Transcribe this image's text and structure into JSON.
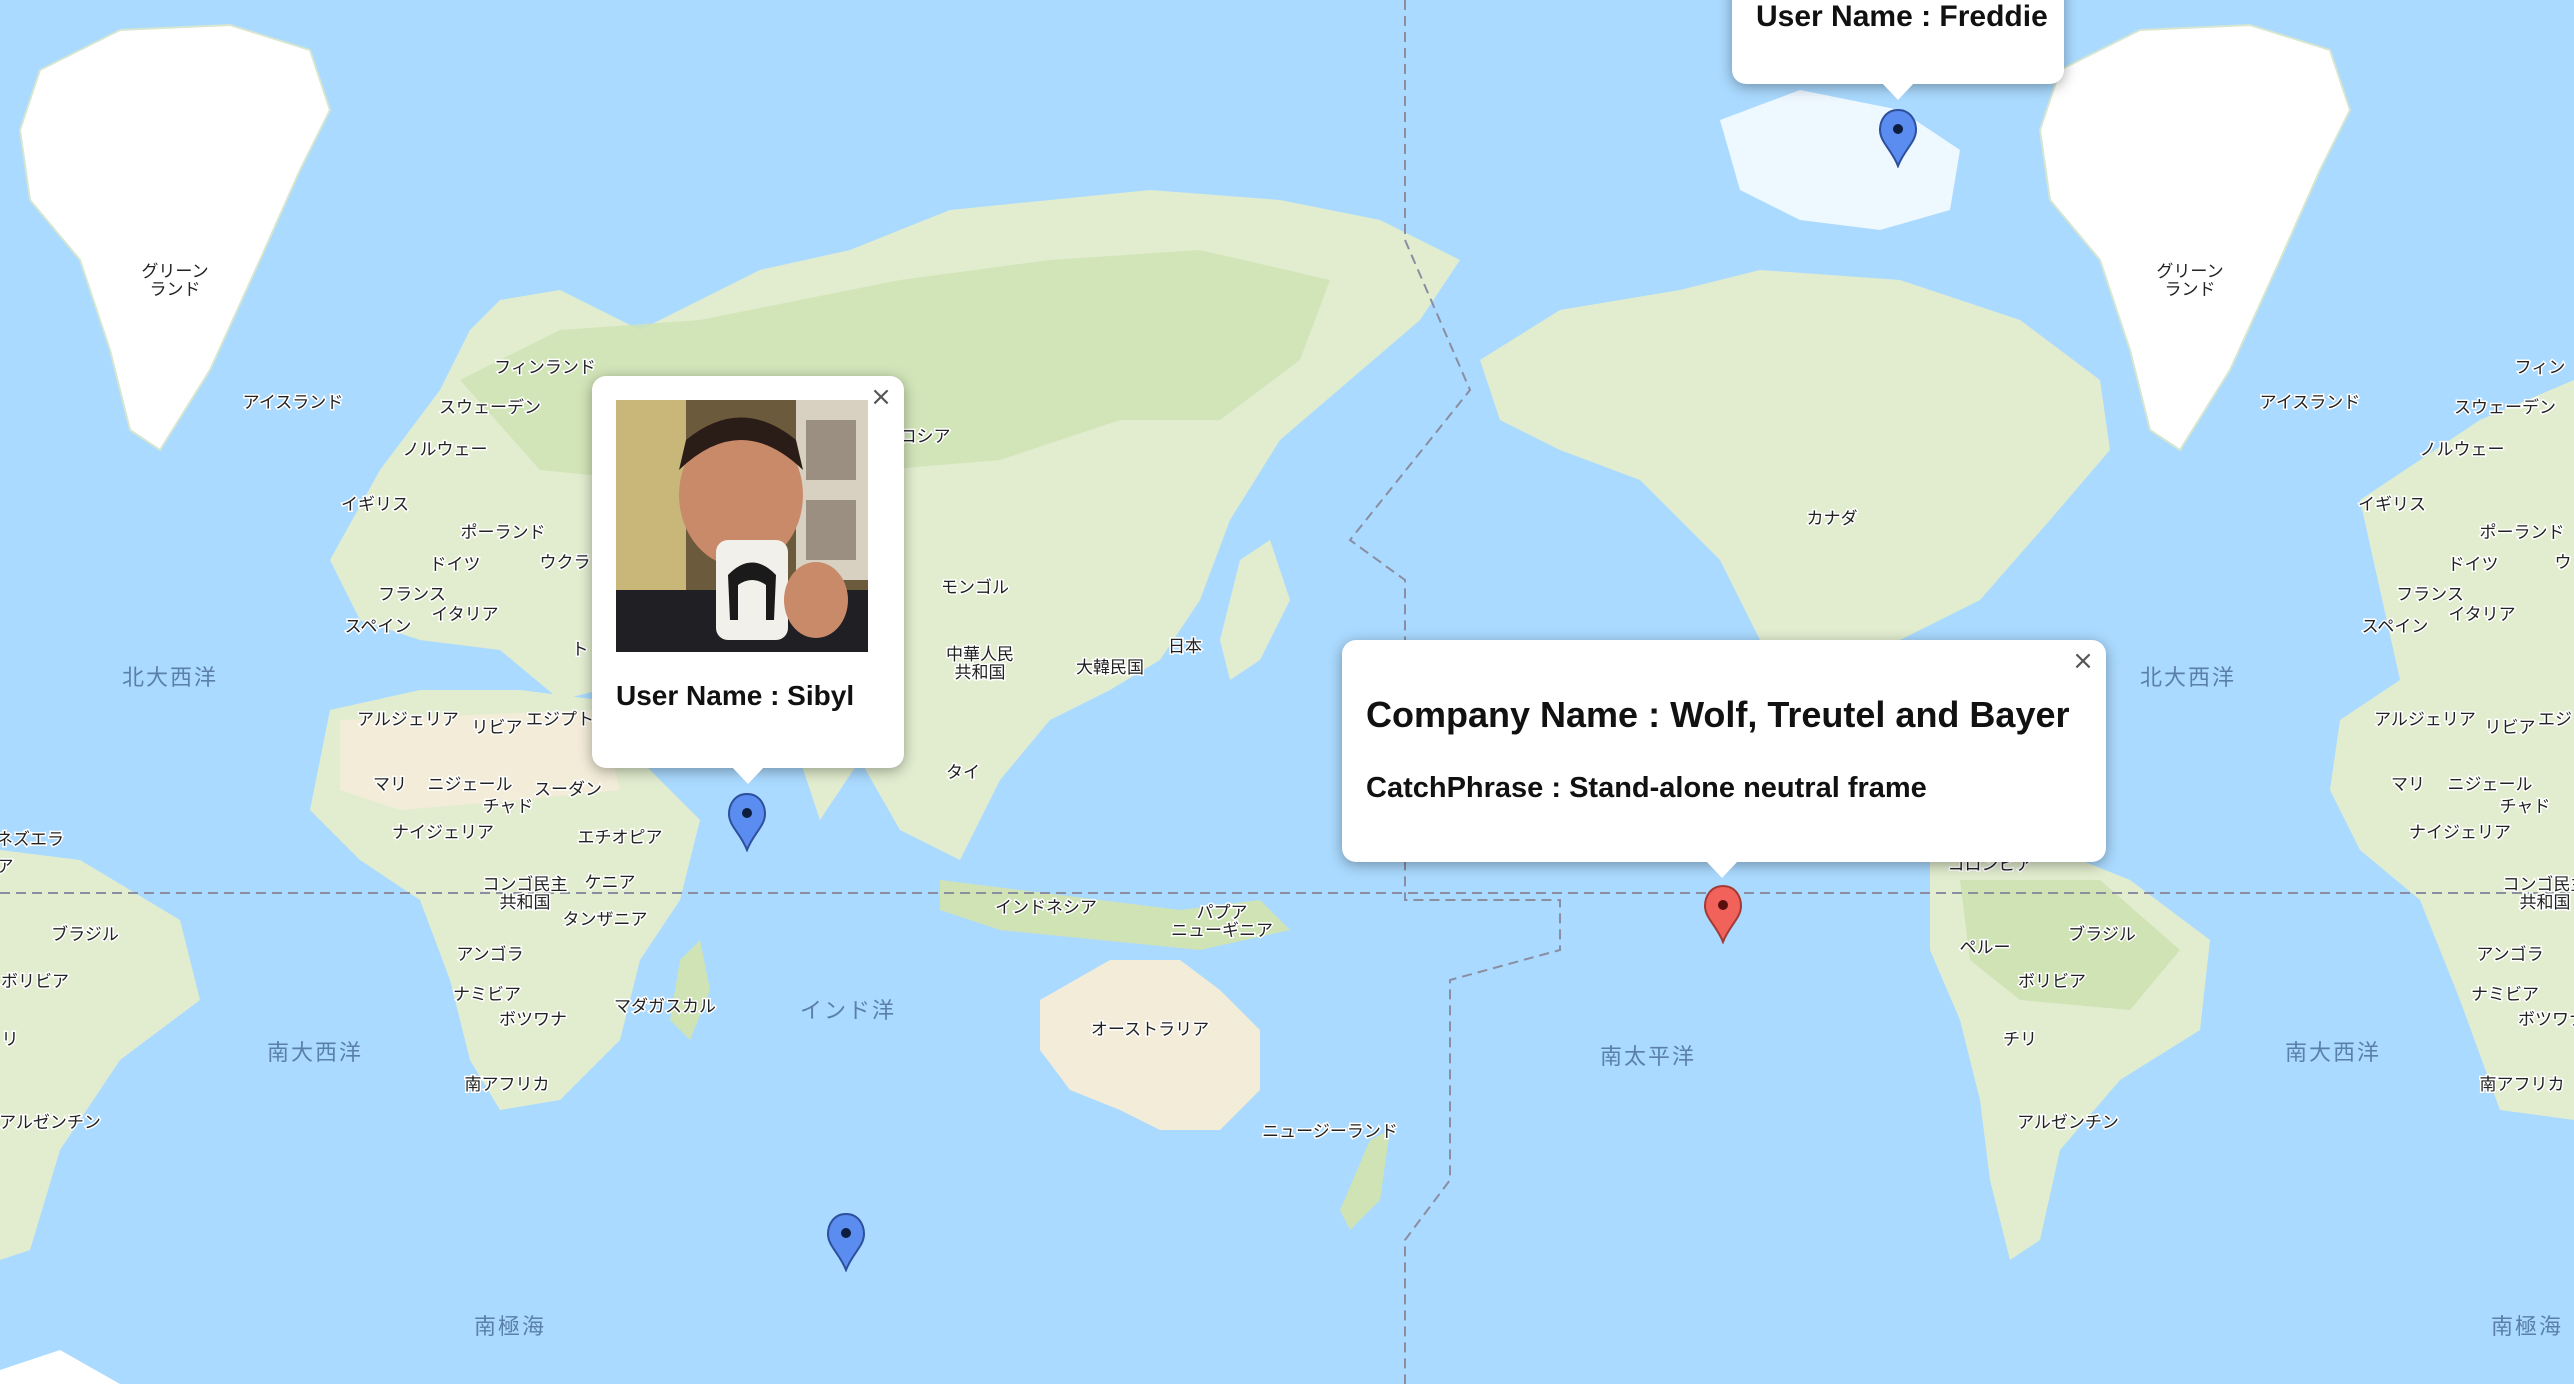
{
  "map": {
    "country_labels": [
      {
        "id": "greenland-w",
        "text": "グリーン\nランド"
      },
      {
        "id": "greenland-e",
        "text": "グリーン\nランド"
      },
      {
        "id": "iceland-w",
        "text": "アイスランド"
      },
      {
        "id": "iceland-e",
        "text": "アイスランド"
      },
      {
        "id": "finland",
        "text": "フィンランド"
      },
      {
        "id": "finland-e",
        "text": "フィン"
      },
      {
        "id": "sweden",
        "text": "スウェーデン"
      },
      {
        "id": "sweden-e",
        "text": "スウェーデン"
      },
      {
        "id": "norway",
        "text": "ノルウェー"
      },
      {
        "id": "norway-e",
        "text": "ノルウェー"
      },
      {
        "id": "uk",
        "text": "イギリス"
      },
      {
        "id": "uk-e",
        "text": "イギリス"
      },
      {
        "id": "poland",
        "text": "ポーランド"
      },
      {
        "id": "poland-e",
        "text": "ポーランド"
      },
      {
        "id": "germany",
        "text": "ドイツ"
      },
      {
        "id": "germany-e",
        "text": "ドイツ"
      },
      {
        "id": "ukraine",
        "text": "ウクラ"
      },
      {
        "id": "ukraine-e",
        "text": "ウ"
      },
      {
        "id": "france",
        "text": "フランス"
      },
      {
        "id": "france-e",
        "text": "フランス"
      },
      {
        "id": "italy",
        "text": "イタリア"
      },
      {
        "id": "italy-e",
        "text": "イタリア"
      },
      {
        "id": "spain",
        "text": "スペイン"
      },
      {
        "id": "spain-e",
        "text": "スペイン"
      },
      {
        "id": "turkey",
        "text": "ト"
      },
      {
        "id": "russia",
        "text": "ロシア"
      },
      {
        "id": "mongolia",
        "text": "モンゴル"
      },
      {
        "id": "china",
        "text": "中華人民\n共和国"
      },
      {
        "id": "korea",
        "text": "大韓民国"
      },
      {
        "id": "japan",
        "text": "日本"
      },
      {
        "id": "thailand",
        "text": "タイ"
      },
      {
        "id": "indonesia",
        "text": "インドネシア"
      },
      {
        "id": "png",
        "text": "パプア\nニューギニア"
      },
      {
        "id": "australia",
        "text": "オーストラリア"
      },
      {
        "id": "nz",
        "text": "ニュージーランド"
      },
      {
        "id": "algeria",
        "text": "アルジェリア"
      },
      {
        "id": "algeria-e",
        "text": "アルジェリア"
      },
      {
        "id": "libya",
        "text": "リビア"
      },
      {
        "id": "libya-e",
        "text": "リビア"
      },
      {
        "id": "egypt",
        "text": "エジプト"
      },
      {
        "id": "egypt-e",
        "text": "エジ"
      },
      {
        "id": "mali",
        "text": "マリ"
      },
      {
        "id": "mali-e",
        "text": "マリ"
      },
      {
        "id": "niger",
        "text": "ニジェール"
      },
      {
        "id": "niger-e",
        "text": "ニジェール"
      },
      {
        "id": "chad",
        "text": "チャド"
      },
      {
        "id": "chad-e",
        "text": "チャド"
      },
      {
        "id": "sudan",
        "text": "スーダン"
      },
      {
        "id": "nigeria",
        "text": "ナイジェリア"
      },
      {
        "id": "nigeria-e",
        "text": "ナイジェリア"
      },
      {
        "id": "ethiopia",
        "text": "エチオピア"
      },
      {
        "id": "drc",
        "text": "コンゴ民主\n共和国"
      },
      {
        "id": "drc-e",
        "text": "コンゴ民主\n共和国"
      },
      {
        "id": "kenya",
        "text": "ケニア"
      },
      {
        "id": "tanzania",
        "text": "タンザニア"
      },
      {
        "id": "angola",
        "text": "アンゴラ"
      },
      {
        "id": "angola-e",
        "text": "アンゴラ"
      },
      {
        "id": "namibia",
        "text": "ナミビア"
      },
      {
        "id": "namibia-e",
        "text": "ナミビア"
      },
      {
        "id": "botswana",
        "text": "ボツワナ"
      },
      {
        "id": "botswana-e",
        "text": "ボツワナ"
      },
      {
        "id": "madagascar",
        "text": "マダガスカル"
      },
      {
        "id": "south-africa",
        "text": "南アフリカ"
      },
      {
        "id": "south-africa-e",
        "text": "南アフリカ"
      },
      {
        "id": "venezuela",
        "text": "ネズエラ"
      },
      {
        "id": "brazil-w",
        "text": "ブラジル"
      },
      {
        "id": "brazil-e",
        "text": "ブラジル"
      },
      {
        "id": "bolivia-w",
        "text": "ボリビア"
      },
      {
        "id": "bolivia-e",
        "text": "ボリビア"
      },
      {
        "id": "argentina-w",
        "text": "アルゼンチン"
      },
      {
        "id": "argentina-e",
        "text": "アルゼンチン"
      },
      {
        "id": "chile-w",
        "text": "リ"
      },
      {
        "id": "chile-e",
        "text": "チリ"
      },
      {
        "id": "peru",
        "text": "ペルー"
      },
      {
        "id": "colombia",
        "text": "コロンビア"
      },
      {
        "id": "canada",
        "text": "カナダ"
      },
      {
        "id": "frag-a",
        "text": "ア"
      }
    ],
    "ocean_labels": [
      {
        "id": "north-atlantic-w",
        "text": "北大西洋"
      },
      {
        "id": "north-atlantic-e",
        "text": "北大西洋"
      },
      {
        "id": "south-atlantic-w",
        "text": "南大西洋"
      },
      {
        "id": "south-atlantic-e",
        "text": "南大西洋"
      },
      {
        "id": "indian-ocean",
        "text": "インド洋"
      },
      {
        "id": "south-pacific",
        "text": "南太平洋"
      },
      {
        "id": "southern-ocean-w",
        "text": "南極海"
      },
      {
        "id": "southern-ocean-e",
        "text": "南極海"
      }
    ]
  },
  "popups": {
    "freddie": {
      "user_name": "User Name : Freddie"
    },
    "sibyl": {
      "user_name": "User Name : Sibyl",
      "close": "×",
      "photo_alt": "user-photo"
    },
    "company": {
      "company_name": "Company Name : Wolf, Treutel and Bayer",
      "catch_phrase": "CatchPhrase : Stand-alone neutral frame",
      "close": "×"
    }
  },
  "markers": [
    {
      "id": "marker-freddie",
      "color": "#5b8df0"
    },
    {
      "id": "marker-sibyl",
      "color": "#5b8df0"
    },
    {
      "id": "marker-company",
      "color": "#f0625a"
    },
    {
      "id": "marker-southern",
      "color": "#5b8df0"
    }
  ],
  "colors": {
    "ocean": "#aadaff",
    "land": "#e2edcf",
    "green": "#cfe3b5",
    "desert": "#f3ecd8",
    "ice": "#ffffff"
  }
}
